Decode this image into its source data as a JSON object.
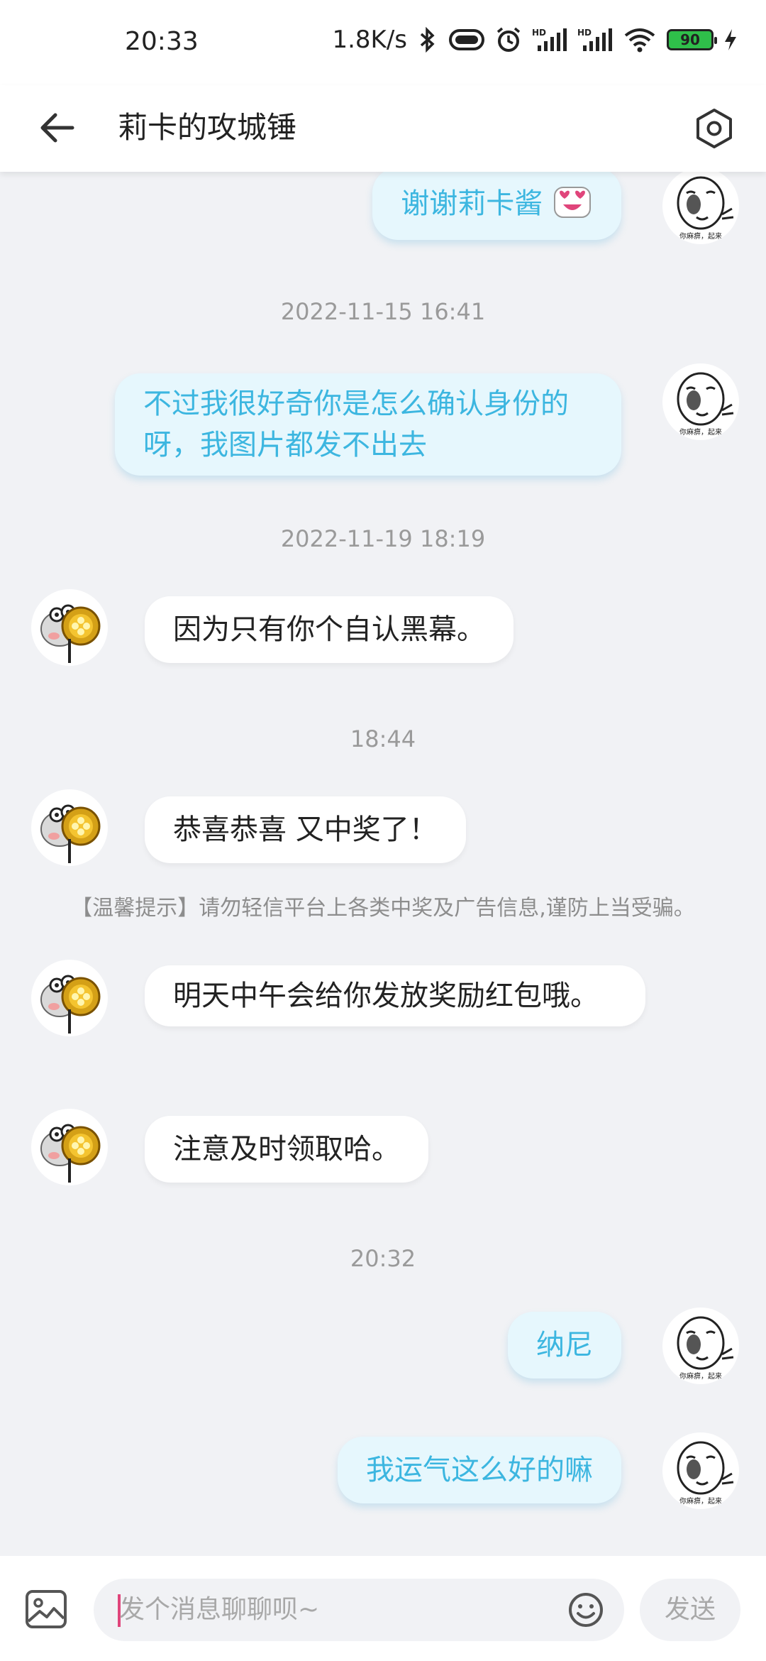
{
  "status": {
    "time": "20:33",
    "net_speed": "1.8K/s",
    "battery": "90",
    "icons": [
      "bluetooth-icon",
      "vibrate-icon",
      "alarm-icon",
      "hd-signal-icon",
      "hd-signal-icon",
      "wifi-icon",
      "battery-icon",
      "charging-icon"
    ]
  },
  "header": {
    "title": "莉卡的攻城锤",
    "back_icon": "arrow-left-icon",
    "settings_icon": "hexagon-settings-icon"
  },
  "messages": [
    {
      "kind": "bubble",
      "side": "me",
      "text": "谢谢莉卡酱",
      "emoji": "heart-eyes-emoji"
    },
    {
      "kind": "time",
      "text": "2022-11-15 16:41"
    },
    {
      "kind": "bubble",
      "side": "me",
      "text": "不过我很好奇你是怎么确认身份的呀，我图片都发不出去"
    },
    {
      "kind": "time",
      "text": "2022-11-19 18:19"
    },
    {
      "kind": "bubble",
      "side": "other",
      "text": "因为只有你个自认黑幕。"
    },
    {
      "kind": "time",
      "text": "18:44"
    },
    {
      "kind": "bubble",
      "side": "other",
      "text": "恭喜恭喜 又中奖了！"
    },
    {
      "kind": "notice",
      "text": "【温馨提示】请勿轻信平台上各类中奖及广告信息,谨防上当受骗。"
    },
    {
      "kind": "bubble",
      "side": "other",
      "text": "明天中午会给你发放奖励红包哦。"
    },
    {
      "kind": "bubble",
      "side": "other",
      "text": "注意及时领取哈。"
    },
    {
      "kind": "time",
      "text": "20:32"
    },
    {
      "kind": "bubble",
      "side": "me",
      "text": "纳尼"
    },
    {
      "kind": "bubble",
      "side": "me",
      "text": "我运气这么好的嘛"
    }
  ],
  "input": {
    "placeholder": "发个消息聊聊呗~",
    "send_label": "发送",
    "image_icon": "image-icon",
    "emoji_icon": "emoji-icon"
  },
  "colors": {
    "me_bubble_bg": "#e6f7fd",
    "me_bubble_text": "#3cb6e0",
    "other_bubble_bg": "#ffffff",
    "background": "#f1f2f5",
    "cursor": "#e0457b"
  }
}
